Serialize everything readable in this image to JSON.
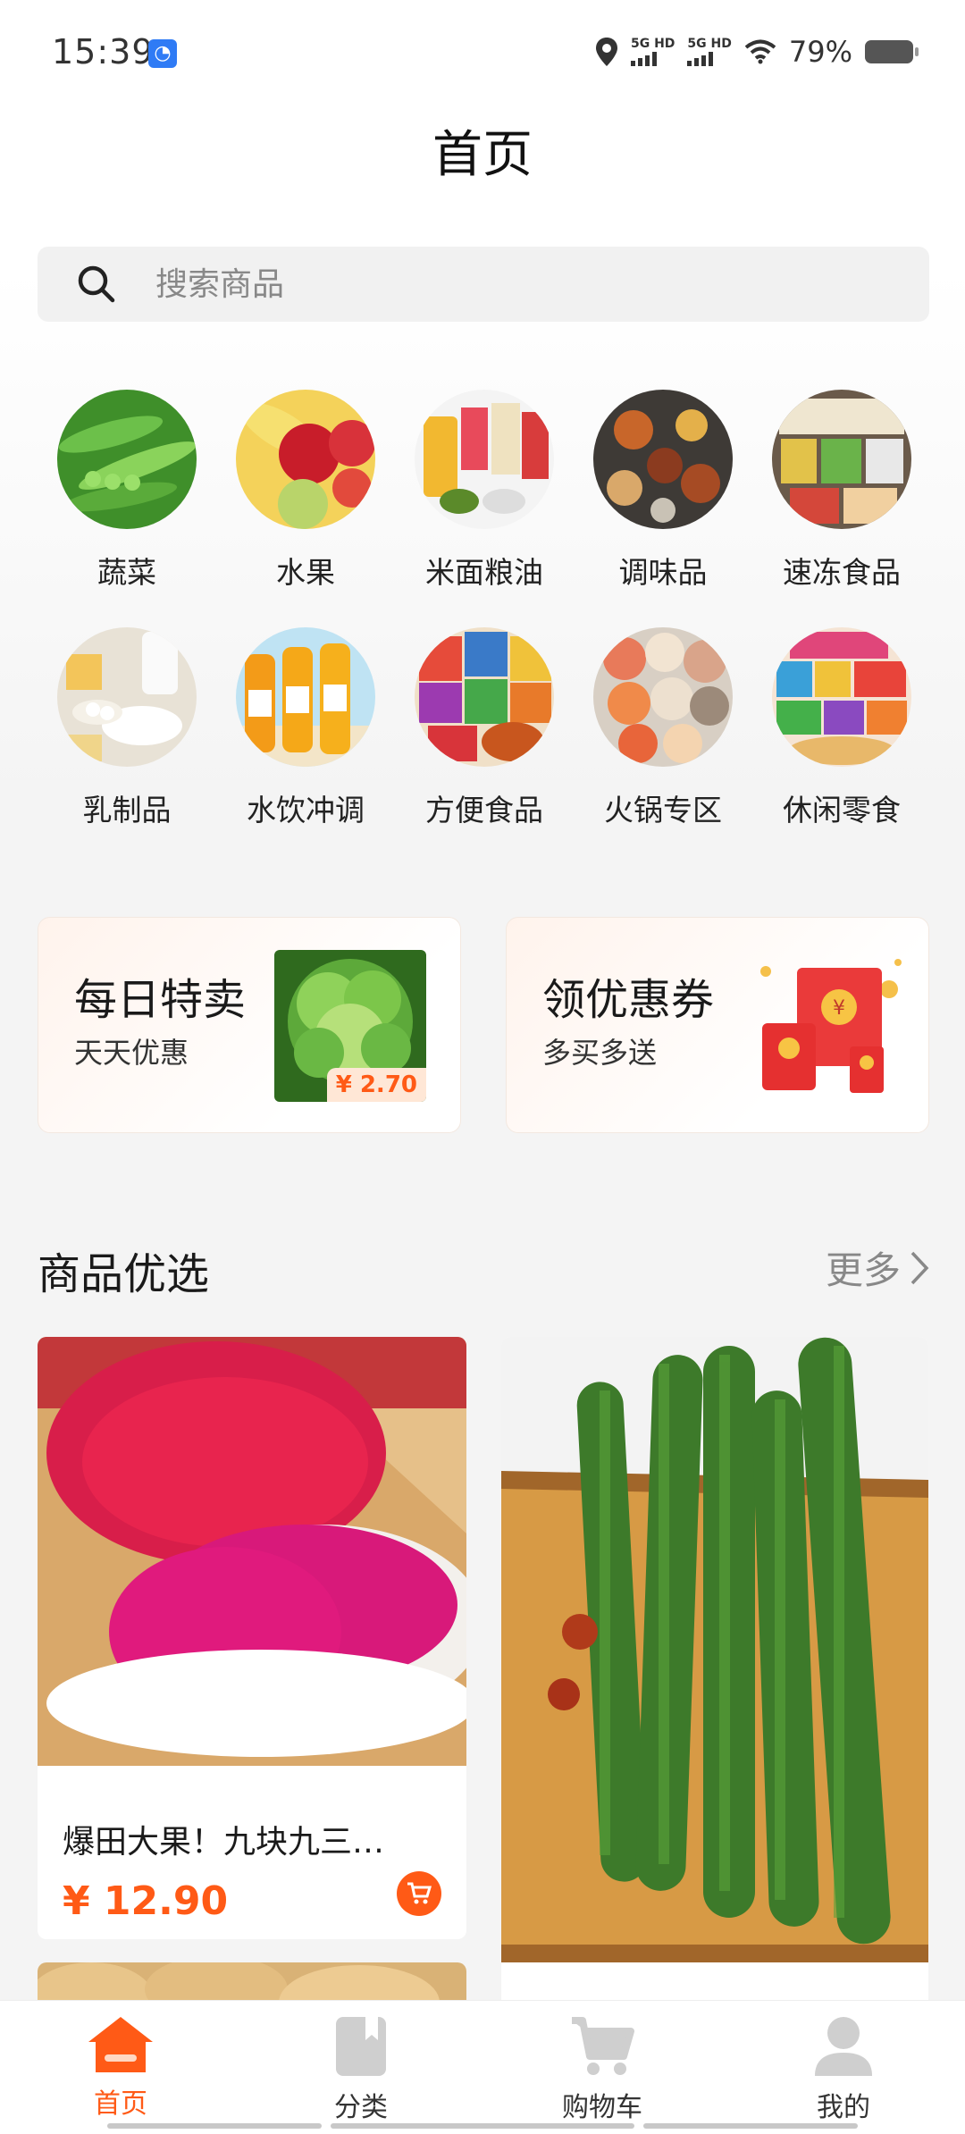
{
  "status_bar": {
    "time": "15:39",
    "network_1": "5G HD",
    "network_2": "5G HD",
    "battery": "79%"
  },
  "header": {
    "title": "首页"
  },
  "search": {
    "placeholder": "搜索商品"
  },
  "categories": [
    {
      "label": "蔬菜",
      "icon": "vegetables-image"
    },
    {
      "label": "水果",
      "icon": "fruits-image"
    },
    {
      "label": "米面粮油",
      "icon": "grain-oil-image"
    },
    {
      "label": "调味品",
      "icon": "seasoning-image"
    },
    {
      "label": "速冻食品",
      "icon": "frozen-food-image"
    },
    {
      "label": "乳制品",
      "icon": "dairy-image"
    },
    {
      "label": "水饮冲调",
      "icon": "drinks-image"
    },
    {
      "label": "方便食品",
      "icon": "instant-food-image"
    },
    {
      "label": "火锅专区",
      "icon": "hotpot-image"
    },
    {
      "label": "休闲零食",
      "icon": "snacks-image"
    }
  ],
  "promos": {
    "daily": {
      "title": "每日特卖",
      "subtitle": "天天优惠",
      "price": "¥ 2.70"
    },
    "coupon": {
      "title": "领优惠券",
      "subtitle": "多买多送"
    }
  },
  "section": {
    "title": "商品优选",
    "more": "更多"
  },
  "products": [
    {
      "name": "爆田大果！九块九三…",
      "price": "¥ 12.90"
    }
  ],
  "tabbar": [
    {
      "label": "首页",
      "active": true
    },
    {
      "label": "分类",
      "active": false
    },
    {
      "label": "购物车",
      "active": false
    },
    {
      "label": "我的",
      "active": false
    }
  ],
  "colors": {
    "accent": "#ff5a16"
  }
}
